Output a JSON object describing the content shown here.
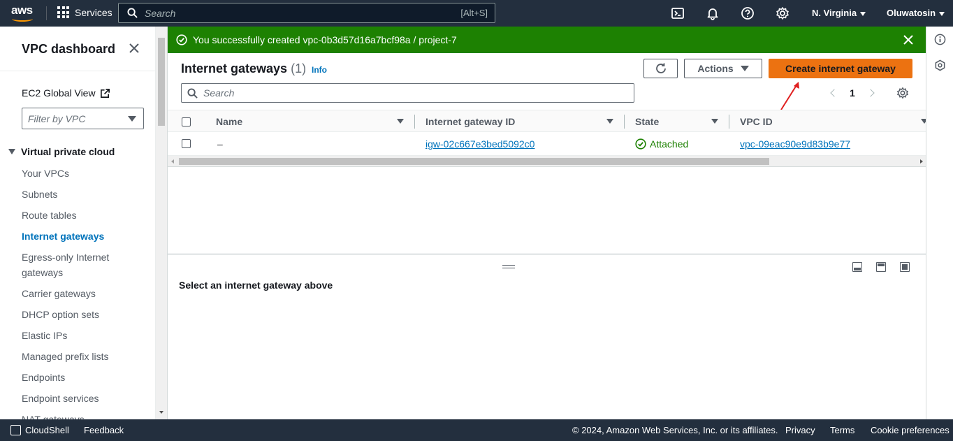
{
  "topnav": {
    "logo_text": "aws",
    "services_label": "Services",
    "search_placeholder": "Search",
    "search_shortcut": "[Alt+S]",
    "region": "N. Virginia",
    "user": "Oluwatosin"
  },
  "sidebar": {
    "title": "VPC dashboard",
    "ec2_global_view": "EC2 Global View",
    "filter_placeholder": "Filter by VPC",
    "section": "Virtual private cloud",
    "items": [
      {
        "label": "Your VPCs",
        "active": false
      },
      {
        "label": "Subnets",
        "active": false
      },
      {
        "label": "Route tables",
        "active": false
      },
      {
        "label": "Internet gateways",
        "active": true
      },
      {
        "label": "Egress-only Internet gateways",
        "active": false
      },
      {
        "label": "Carrier gateways",
        "active": false
      },
      {
        "label": "DHCP option sets",
        "active": false
      },
      {
        "label": "Elastic IPs",
        "active": false
      },
      {
        "label": "Managed prefix lists",
        "active": false
      },
      {
        "label": "Endpoints",
        "active": false
      },
      {
        "label": "Endpoint services",
        "active": false
      },
      {
        "label": "NAT gateways",
        "active": false
      }
    ]
  },
  "flash": {
    "message": "You successfully created vpc-0b3d57d16a7bcf98a / project-7",
    "color": "#1d8102"
  },
  "table_panel": {
    "title": "Internet gateways",
    "count": "(1)",
    "info": "Info",
    "actions_label": "Actions",
    "create_label": "Create internet gateway",
    "search_placeholder": "Search",
    "page": "1",
    "columns": [
      "Name",
      "Internet gateway ID",
      "State",
      "VPC ID"
    ],
    "rows": [
      {
        "name": "–",
        "id": "igw-02c667e3bed5092c0",
        "state": "Attached",
        "vpc_id": "vpc-09eac90e9d83b9e77"
      }
    ]
  },
  "detail": {
    "empty_text": "Select an internet gateway above"
  },
  "footer": {
    "cloudshell": "CloudShell",
    "feedback": "Feedback",
    "copyright": "© 2024, Amazon Web Services, Inc. or its affiliates.",
    "privacy": "Privacy",
    "terms": "Terms",
    "cookie": "Cookie preferences"
  },
  "colors": {
    "nav_bg": "#232f3e",
    "primary_button": "#ec7211",
    "link": "#0073bb",
    "success": "#1d8102"
  }
}
